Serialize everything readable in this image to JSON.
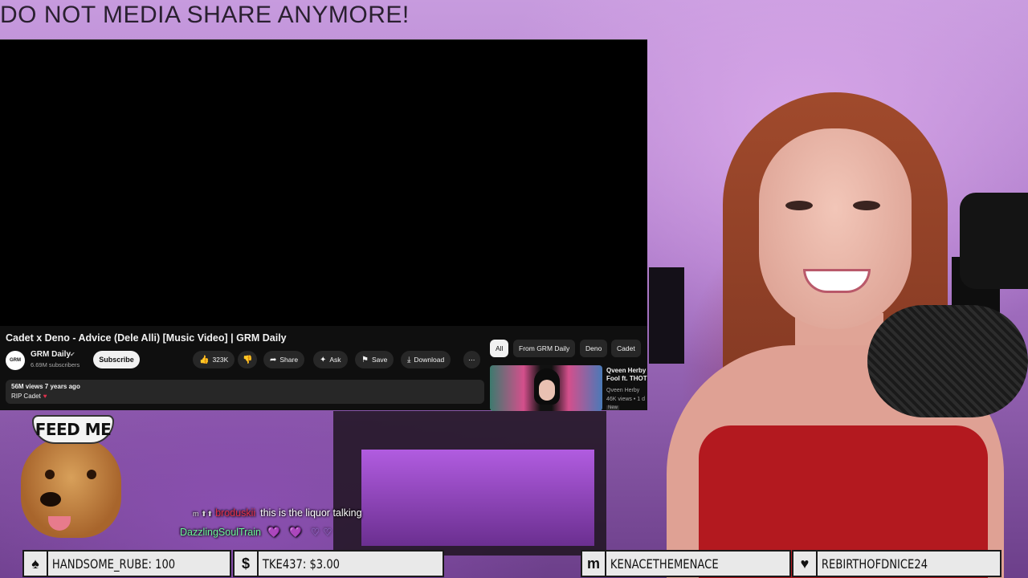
{
  "banner": {
    "text": "DO NOT MEDIA SHARE ANYMORE!"
  },
  "youtube": {
    "video_title": "Cadet x Deno - Advice (Dele Alli) [Music Video] | GRM Daily",
    "channel": {
      "avatar_text": "GRM",
      "name": "GRM Daily",
      "subscribers": "6.69M subscribers",
      "subscribe_label": "Subscribe"
    },
    "actions": {
      "like_count": "323K",
      "share_label": "Share",
      "ask_label": "Ask",
      "save_label": "Save",
      "download_label": "Download",
      "more_label": "⋯"
    },
    "description": {
      "meta": "56M views  7 years ago",
      "text": "RIP Cadet"
    },
    "chips": [
      "All",
      "From GRM Daily",
      "Deno",
      "Cadet"
    ],
    "recommendation": {
      "title_line1": "Qveen Herby",
      "title_line2": "Fool ft. THOT",
      "channel": "Qveen Herby",
      "views": "46K views • 1 d",
      "badge": "New"
    }
  },
  "overlay": {
    "feed_me_label": "FEED ME"
  },
  "chat": [
    {
      "user": "broduskii",
      "message": "this is the liquor talking",
      "badges": "m ⬆⬆"
    },
    {
      "user": "DazzlingSoulTrain",
      "message": "",
      "emotes": "💜 💜 ♡♡"
    }
  ],
  "tickers": [
    {
      "icon": "♠",
      "text": "HANDSOME_RUBE: 100"
    },
    {
      "icon": "$",
      "text": "TKE437: $3.00"
    },
    {
      "icon": "m",
      "text": "KENACETHEMENACE"
    },
    {
      "icon": "♥",
      "text": "REBIRTHOFDNICE24"
    }
  ],
  "colors": {
    "youtube_bg": "#0f0f0f",
    "chat_username_red": "#e0304a",
    "chat_username_green": "#6df59a",
    "ticker_bg": "#e9e9e9"
  }
}
